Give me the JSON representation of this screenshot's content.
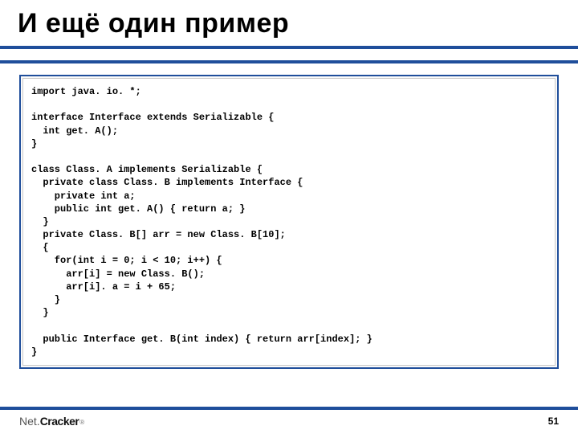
{
  "slide": {
    "title": "И ещё один пример",
    "code": "import java. io. *;\n\ninterface Interface extends Serializable {\n  int get. A();\n}\n\nclass Class. A implements Serializable {\n  private class Class. B implements Interface {\n    private int a;\n    public int get. A() { return a; }\n  }\n  private Class. B[] arr = new Class. B[10];\n  {\n    for(int i = 0; i < 10; i++) {\n      arr[i] = new Class. B();\n      arr[i]. a = i + 65;\n    }\n  }\n\n  public Interface get. B(int index) { return arr[index]; }\n}"
  },
  "footer": {
    "logo_net": "Net.",
    "logo_cracker": "Cracker",
    "logo_reg": "®",
    "page_number": "51"
  },
  "colors": {
    "accent": "#1f4e9b"
  }
}
